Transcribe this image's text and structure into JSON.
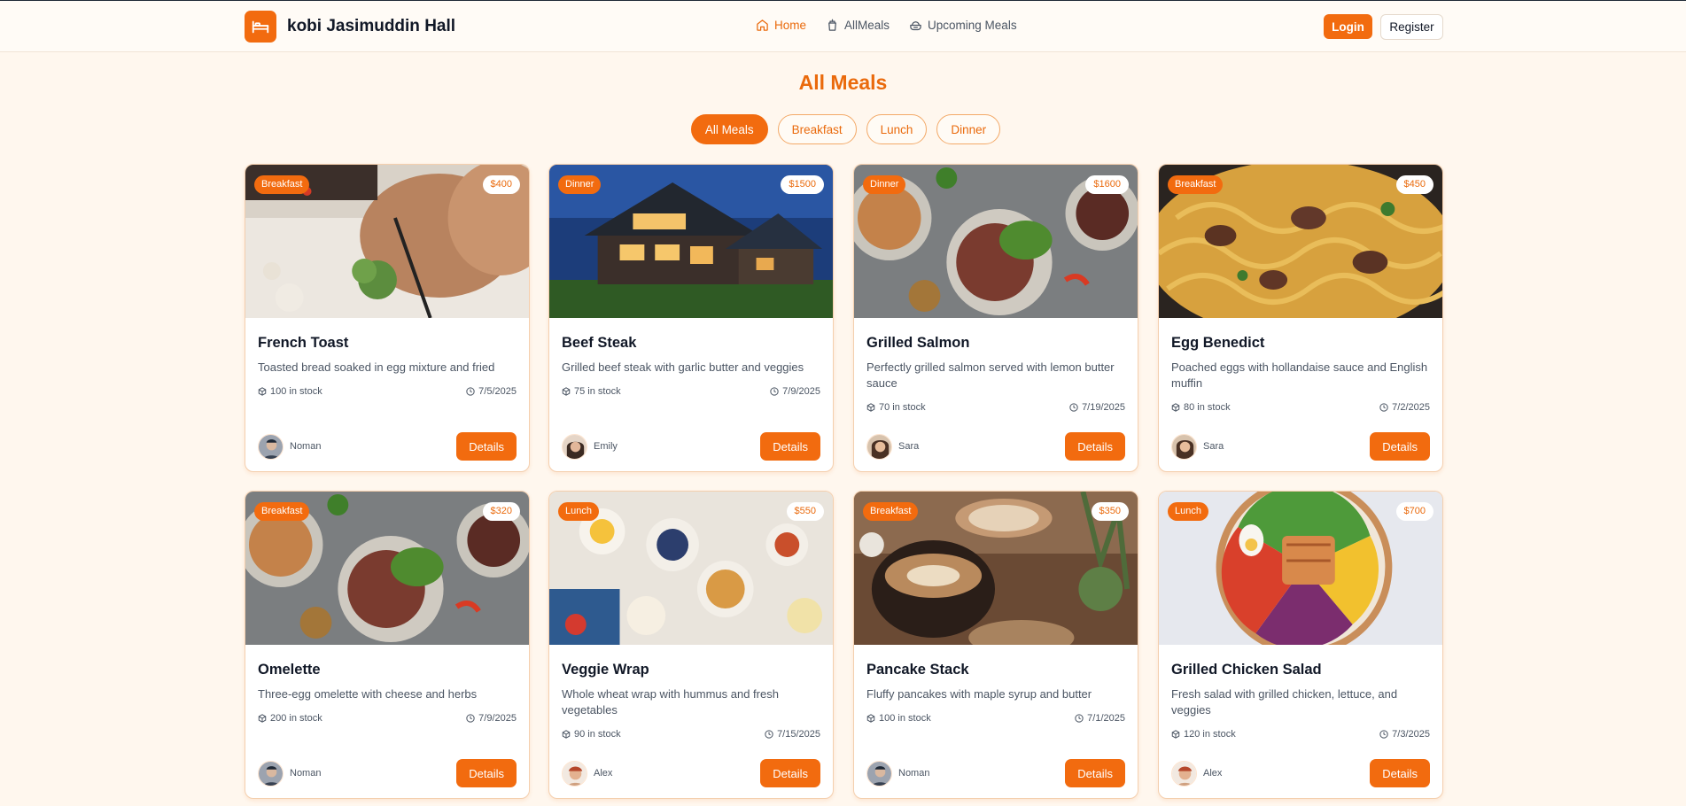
{
  "brand": {
    "name": "kobi Jasimuddin Hall"
  },
  "nav": [
    {
      "label": "Home",
      "icon": "home-icon",
      "active": true
    },
    {
      "label": "AllMeals",
      "icon": "cup-icon",
      "active": false
    },
    {
      "label": "Upcoming Meals",
      "icon": "bowl-icon",
      "active": false
    }
  ],
  "auth": {
    "login": "Login",
    "register": "Register"
  },
  "page": {
    "title": "All Meals"
  },
  "filters": [
    {
      "label": "All Meals",
      "active": true
    },
    {
      "label": "Breakfast",
      "active": false
    },
    {
      "label": "Lunch",
      "active": false
    },
    {
      "label": "Dinner",
      "active": false
    }
  ],
  "meals": [
    {
      "category": "Breakfast",
      "price": "$400",
      "title": "French Toast",
      "description": "Toasted bread soaked in egg mixture and fried",
      "stock": "100 in stock",
      "date": "7/5/2025",
      "user": "Noman",
      "details": "Details",
      "image": "chopping-vegetables"
    },
    {
      "category": "Dinner",
      "price": "$1500",
      "title": "Beef Steak",
      "description": "Grilled beef steak with garlic butter and veggies",
      "stock": "75 in stock",
      "date": "7/9/2025",
      "user": "Emily",
      "details": "Details",
      "image": "house-at-night"
    },
    {
      "category": "Dinner",
      "price": "$1600",
      "title": "Grilled Salmon",
      "description": "Perfectly grilled salmon served with lemon butter sauce",
      "stock": "70 in stock",
      "date": "7/19/2025",
      "user": "Sara",
      "details": "Details",
      "image": "plated-dishes"
    },
    {
      "category": "Breakfast",
      "price": "$450",
      "title": "Egg Benedict",
      "description": "Poached eggs with hollandaise sauce and English muffin",
      "stock": "80 in stock",
      "date": "7/2/2025",
      "user": "Sara",
      "details": "Details",
      "image": "pasta-with-beef"
    },
    {
      "category": "Breakfast",
      "price": "$320",
      "title": "Omelette",
      "description": "Three-egg omelette with cheese and herbs",
      "stock": "200 in stock",
      "date": "7/9/2025",
      "user": "Noman",
      "details": "Details",
      "image": "plated-dishes"
    },
    {
      "category": "Lunch",
      "price": "$550",
      "title": "Veggie Wrap",
      "description": "Whole wheat wrap with hummus and fresh vegetables",
      "stock": "90 in stock",
      "date": "7/15/2025",
      "user": "Alex",
      "details": "Details",
      "image": "breakfast-table"
    },
    {
      "category": "Breakfast",
      "price": "$350",
      "title": "Pancake Stack",
      "description": "Fluffy pancakes with maple syrup and butter",
      "stock": "100 in stock",
      "date": "7/1/2025",
      "user": "Noman",
      "details": "Details",
      "image": "coffee-cups"
    },
    {
      "category": "Lunch",
      "price": "$700",
      "title": "Grilled Chicken Salad",
      "description": "Fresh salad with grilled chicken, lettuce, and veggies",
      "stock": "120 in stock",
      "date": "7/3/2025",
      "user": "Alex",
      "details": "Details",
      "image": "salad-bowl"
    }
  ],
  "colors": {
    "accent": "#f26b0f",
    "background": "#fff7ee"
  }
}
